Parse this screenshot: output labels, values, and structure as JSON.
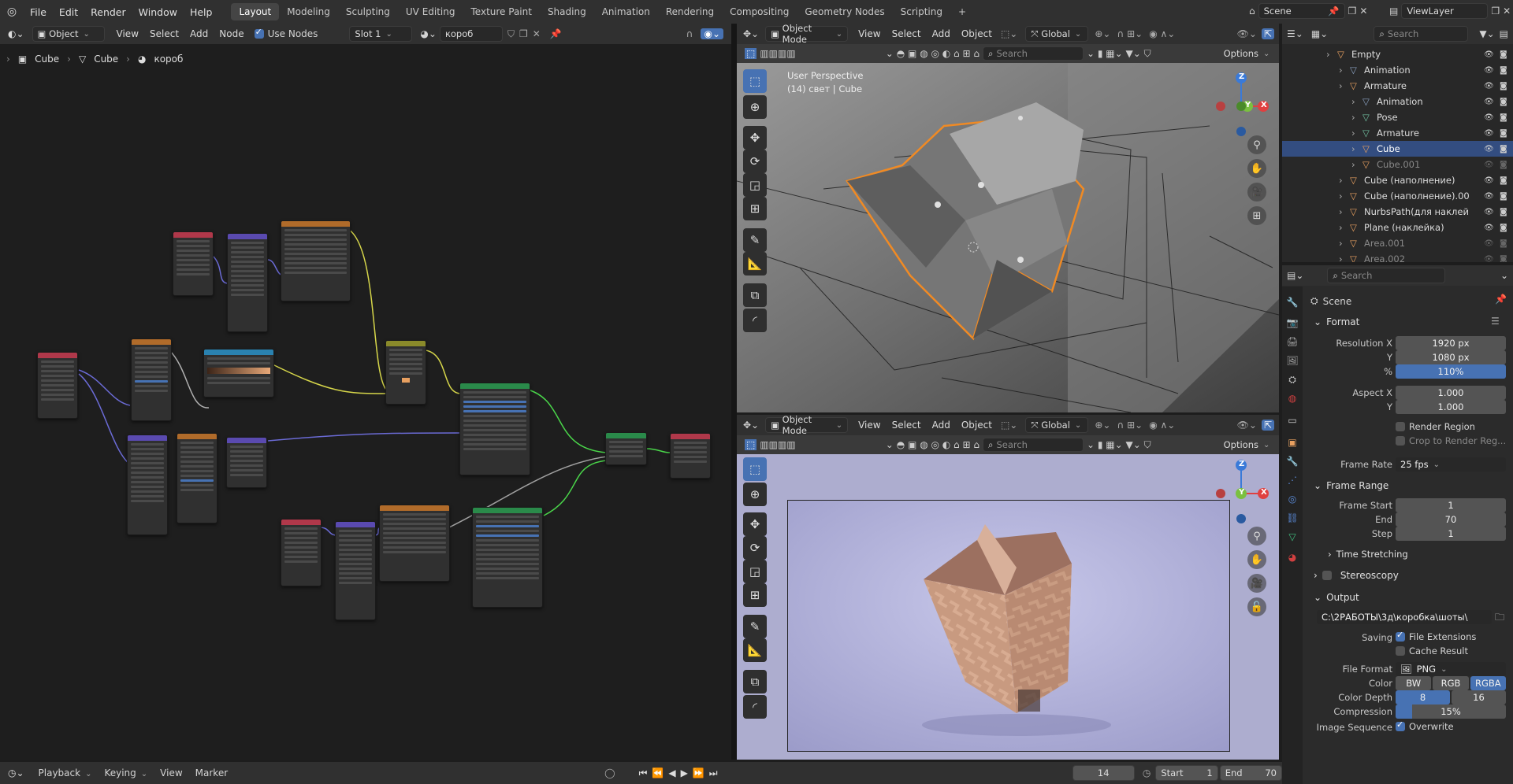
{
  "topbar": {
    "menus": [
      "File",
      "Edit",
      "Render",
      "Window",
      "Help"
    ],
    "workspaces": [
      "Layout",
      "Modeling",
      "Sculpting",
      "UV Editing",
      "Texture Paint",
      "Shading",
      "Animation",
      "Rendering",
      "Compositing",
      "Geometry Nodes",
      "Scripting"
    ],
    "active_workspace": "Layout",
    "scene": "Scene",
    "view_layer": "ViewLayer"
  },
  "node_editor": {
    "object_mode": "Object",
    "menus": [
      "View",
      "Select",
      "Add",
      "Node"
    ],
    "use_nodes": "Use Nodes",
    "slot": "Slot 1",
    "material": "короб",
    "breadcrumb": [
      "Cube",
      "Cube",
      "короб"
    ]
  },
  "viewport_top": {
    "mode": "Object Mode",
    "menus": [
      "View",
      "Select",
      "Add",
      "Object"
    ],
    "orientation": "Global",
    "search_placeholder": "Search",
    "options": "Options",
    "overlay_line1": "User Perspective",
    "overlay_line2": "(14) свет | Cube",
    "axes": [
      "Z",
      "Y",
      "X"
    ]
  },
  "viewport_bottom": {
    "mode": "Object Mode",
    "menus": [
      "View",
      "Select",
      "Add",
      "Object"
    ],
    "orientation": "Global",
    "search_placeholder": "Search",
    "options": "Options",
    "axes": [
      "Z",
      "Y",
      "X"
    ]
  },
  "outliner": {
    "search_placeholder": "Search",
    "items": [
      {
        "label": "Empty",
        "indent": 0,
        "color": "#e8a060",
        "dim": false
      },
      {
        "label": "Animation",
        "indent": 1,
        "color": "#8aa0c0",
        "dim": false
      },
      {
        "label": "Armature",
        "indent": 1,
        "color": "#e8a060",
        "dim": false
      },
      {
        "label": "Animation",
        "indent": 2,
        "color": "#8aa0c0",
        "dim": false
      },
      {
        "label": "Pose",
        "indent": 2,
        "color": "#70c0a0",
        "dim": false
      },
      {
        "label": "Armature",
        "indent": 2,
        "color": "#70c0a0",
        "dim": false
      },
      {
        "label": "Cube",
        "indent": 2,
        "color": "#e8a060",
        "dim": false,
        "selected": true
      },
      {
        "label": "Cube.001",
        "indent": 2,
        "color": "#e8a060",
        "dim": true
      },
      {
        "label": "Cube (наполнение)",
        "indent": 1,
        "color": "#e8a060",
        "dim": false
      },
      {
        "label": "Cube (наполнение).00",
        "indent": 1,
        "color": "#e8a060",
        "dim": false
      },
      {
        "label": "NurbsPath(для наклей",
        "indent": 1,
        "color": "#e8a060",
        "dim": false
      },
      {
        "label": "Plane (наклейка)",
        "indent": 1,
        "color": "#e8a060",
        "dim": false
      },
      {
        "label": "Area.001",
        "indent": 1,
        "color": "#e8a060",
        "dim": true
      },
      {
        "label": "Area.002",
        "indent": 1,
        "color": "#e8a060",
        "dim": true
      }
    ]
  },
  "properties": {
    "search_placeholder": "Search",
    "context": "Scene",
    "format": {
      "title": "Format",
      "res_x_label": "Resolution X",
      "res_x": "1920 px",
      "res_y_label": "Y",
      "res_y": "1080 px",
      "pct_label": "%",
      "pct": "110%",
      "aspect_x_label": "Aspect X",
      "aspect_x": "1.000",
      "aspect_y_label": "Y",
      "aspect_y": "1.000",
      "render_region": "Render Region",
      "crop": "Crop to Render Reg...",
      "frame_rate_label": "Frame Rate",
      "frame_rate": "25 fps"
    },
    "frame_range": {
      "title": "Frame Range",
      "start_label": "Frame Start",
      "start": "1",
      "end_label": "End",
      "end": "70",
      "step_label": "Step",
      "step": "1",
      "time_stretching": "Time Stretching"
    },
    "stereoscopy": "Stereoscopy",
    "output": {
      "title": "Output",
      "path": "C:\\2РАБОТЫ\\3д\\коробка\\шоты\\",
      "saving_label": "Saving",
      "file_ext": "File Extensions",
      "cache": "Cache Result",
      "file_format_label": "File Format",
      "file_format": "PNG",
      "color_label": "Color",
      "color_opts": [
        "BW",
        "RGB",
        "RGBA"
      ],
      "color_active": "RGBA",
      "depth_label": "Color Depth",
      "depth_opts": [
        "8",
        "16"
      ],
      "depth_active": "8",
      "compression_label": "Compression",
      "compression": "15%",
      "compression_value": 0.15,
      "image_seq_label": "Image Sequence",
      "overwrite": "Overwrite"
    }
  },
  "timeline": {
    "menus": [
      "Playback",
      "Keying",
      "View",
      "Marker"
    ],
    "current_frame": "14",
    "start_label": "Start",
    "start": "1",
    "end_label": "End",
    "end": "70"
  },
  "colors": {
    "accent": "#4772b3",
    "selection": "#f08a24",
    "header": "#303030"
  }
}
